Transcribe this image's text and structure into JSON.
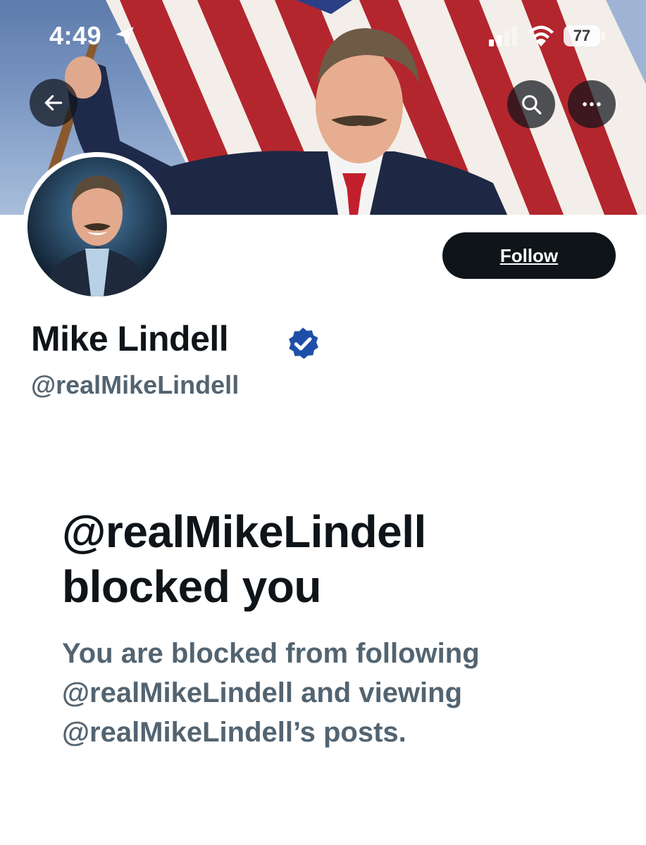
{
  "status_bar": {
    "time": "4:49",
    "battery": "77",
    "icons": [
      "location-arrow-icon",
      "cellular-signal-icon",
      "wifi-icon",
      "battery-icon"
    ]
  },
  "banner": {
    "description_icons": [
      "arrow-left-icon",
      "search-icon",
      "more-icon"
    ]
  },
  "profile": {
    "display_name": "Mike Lindell",
    "handle": "@realMikeLindell",
    "verified": true,
    "follow_label": "Follow"
  },
  "blocked_notice": {
    "title_line1": "@realMikeLindell",
    "title_line2": "blocked you",
    "message_line1": "You are blocked from following",
    "message_line2": "@realMikeLindell and viewing",
    "message_line3": "@realMikeLindell’s posts."
  },
  "colors": {
    "primary_text": "#0f1419",
    "secondary_text": "#536471",
    "verified_blue": "#1d4fa8",
    "button_bg": "#0f1419"
  }
}
